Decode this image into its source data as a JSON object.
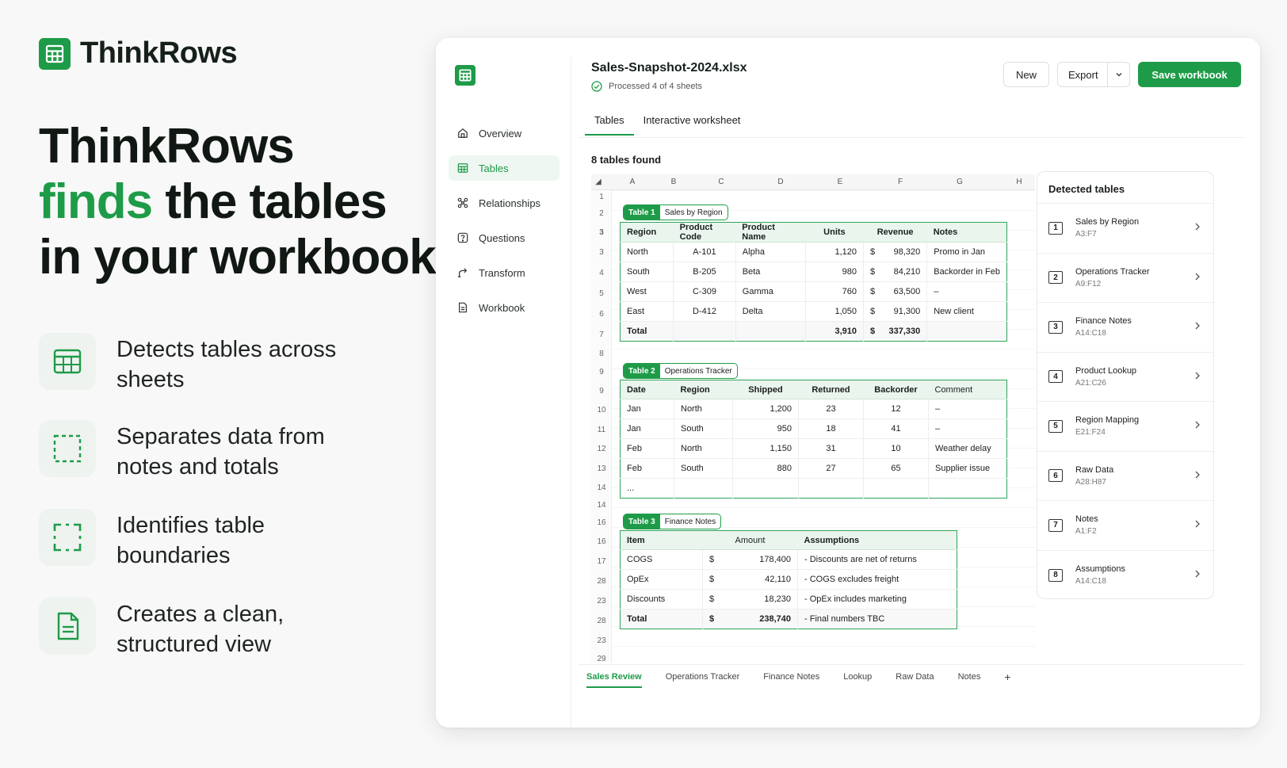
{
  "brand": {
    "name": "ThinkRows"
  },
  "headline": {
    "line1": "ThinkRows",
    "line2_accent": "finds",
    "line2_rest": " the tables",
    "line3": "in your workbook"
  },
  "features": [
    {
      "icon": "table-grid-icon",
      "text": "Detects tables across sheets"
    },
    {
      "icon": "dashed-square-icon",
      "text": "Separates data from notes and totals"
    },
    {
      "icon": "boundary-corners-icon",
      "text": "Identifies table boundaries"
    },
    {
      "icon": "document-icon",
      "text": "Creates a clean, structured view"
    }
  ],
  "app": {
    "nav": [
      {
        "label": "Overview",
        "icon": "home-icon",
        "active": false
      },
      {
        "label": "Tables",
        "icon": "table-icon",
        "active": true
      },
      {
        "label": "Relationships",
        "icon": "relationships-icon",
        "active": false
      },
      {
        "label": "Questions",
        "icon": "question-icon",
        "active": false
      },
      {
        "label": "Transform",
        "icon": "transform-icon",
        "active": false
      },
      {
        "label": "Workbook",
        "icon": "workbook-icon",
        "active": false
      }
    ],
    "file_title": "Sales-Snapshot-2024.xlsx",
    "file_status": "Processed 4 of 4 sheets",
    "buttons": {
      "new": "New",
      "export": "Export",
      "save": "Save workbook"
    },
    "tabs": [
      "Tables",
      "Interactive worksheet"
    ],
    "tables_found": "8 tables found",
    "columns": [
      "A",
      "B",
      "C",
      "D",
      "E",
      "F",
      "G",
      "H"
    ],
    "row_numbers": [
      "1",
      "2",
      "3",
      "3",
      "4",
      "5",
      "6",
      "7",
      "8",
      "9",
      "9",
      "10",
      "11",
      "12",
      "13",
      "14",
      "14",
      "16",
      "16",
      "17",
      "28",
      "23",
      "28",
      "23",
      "29"
    ],
    "table1": {
      "tag": "Table 1",
      "name": "Sales by Region",
      "headers": [
        "Region",
        "Product Code",
        "Product Name",
        "Units",
        "Revenue",
        "Notes"
      ],
      "rows": [
        [
          "North",
          "A-101",
          "Alpha",
          "1,120",
          "$",
          "98,320",
          "Promo in Jan"
        ],
        [
          "South",
          "B-205",
          "Beta",
          "980",
          "$",
          "84,210",
          "Backorder in Feb"
        ],
        [
          "West",
          "C-309",
          "Gamma",
          "760",
          "$",
          "63,500",
          "–"
        ],
        [
          "East",
          "D-412",
          "Delta",
          "1,050",
          "$",
          "91,300",
          "New client"
        ]
      ],
      "total": [
        "Total",
        "",
        "",
        "3,910",
        "$",
        "337,330",
        ""
      ]
    },
    "table2": {
      "tag": "Table 2",
      "name": "Operations Tracker",
      "headers": [
        "Date",
        "Region",
        "Shipped",
        "Returned",
        "Backorder",
        "Comment"
      ],
      "rows": [
        [
          "Jan",
          "North",
          "1,200",
          "23",
          "12",
          "–"
        ],
        [
          "Jan",
          "South",
          "950",
          "18",
          "41",
          "–"
        ],
        [
          "Feb",
          "North",
          "1,150",
          "31",
          "10",
          "Weather delay"
        ],
        [
          "Feb",
          "South",
          "880",
          "27",
          "65",
          "Supplier issue"
        ],
        [
          "...",
          "",
          "",
          "",
          "",
          ""
        ]
      ]
    },
    "table3": {
      "tag": "Table 3",
      "name": "Finance Notes",
      "headers": [
        "Item",
        "Amount",
        "Assumptions"
      ],
      "rows": [
        [
          "COGS",
          "$",
          "178,400",
          "- Discounts are net of returns"
        ],
        [
          "OpEx",
          "$",
          "42,110",
          "- COGS excludes freight"
        ],
        [
          "Discounts",
          "$",
          "18,230",
          "- OpEx includes marketing"
        ]
      ],
      "total": [
        "Total",
        "$",
        "238,740",
        "- Final numbers TBC"
      ]
    },
    "detected": {
      "title": "Detected tables",
      "items": [
        {
          "num": "1",
          "name": "Sales by Region",
          "range": "A3:F7"
        },
        {
          "num": "2",
          "name": "Operations Tracker",
          "range": "A9:F12"
        },
        {
          "num": "3",
          "name": "Finance Notes",
          "range": "A14:C18"
        },
        {
          "num": "4",
          "name": "Product Lookup",
          "range": "A21:C26"
        },
        {
          "num": "5",
          "name": "Region Mapping",
          "range": "E21:F24"
        },
        {
          "num": "6",
          "name": "Raw Data",
          "range": "A28:H87"
        },
        {
          "num": "7",
          "name": "Notes",
          "range": "A1:F2"
        },
        {
          "num": "8",
          "name": "Assumptions",
          "range": "A14:C18"
        }
      ]
    },
    "sheets": [
      "Sales Review",
      "Operations Tracker",
      "Finance Notes",
      "Lookup",
      "Raw Data",
      "Notes"
    ],
    "add_sheet": "+",
    "colors": {
      "accent": "#1e9b48",
      "accent_light": "#eaf5ed"
    }
  }
}
